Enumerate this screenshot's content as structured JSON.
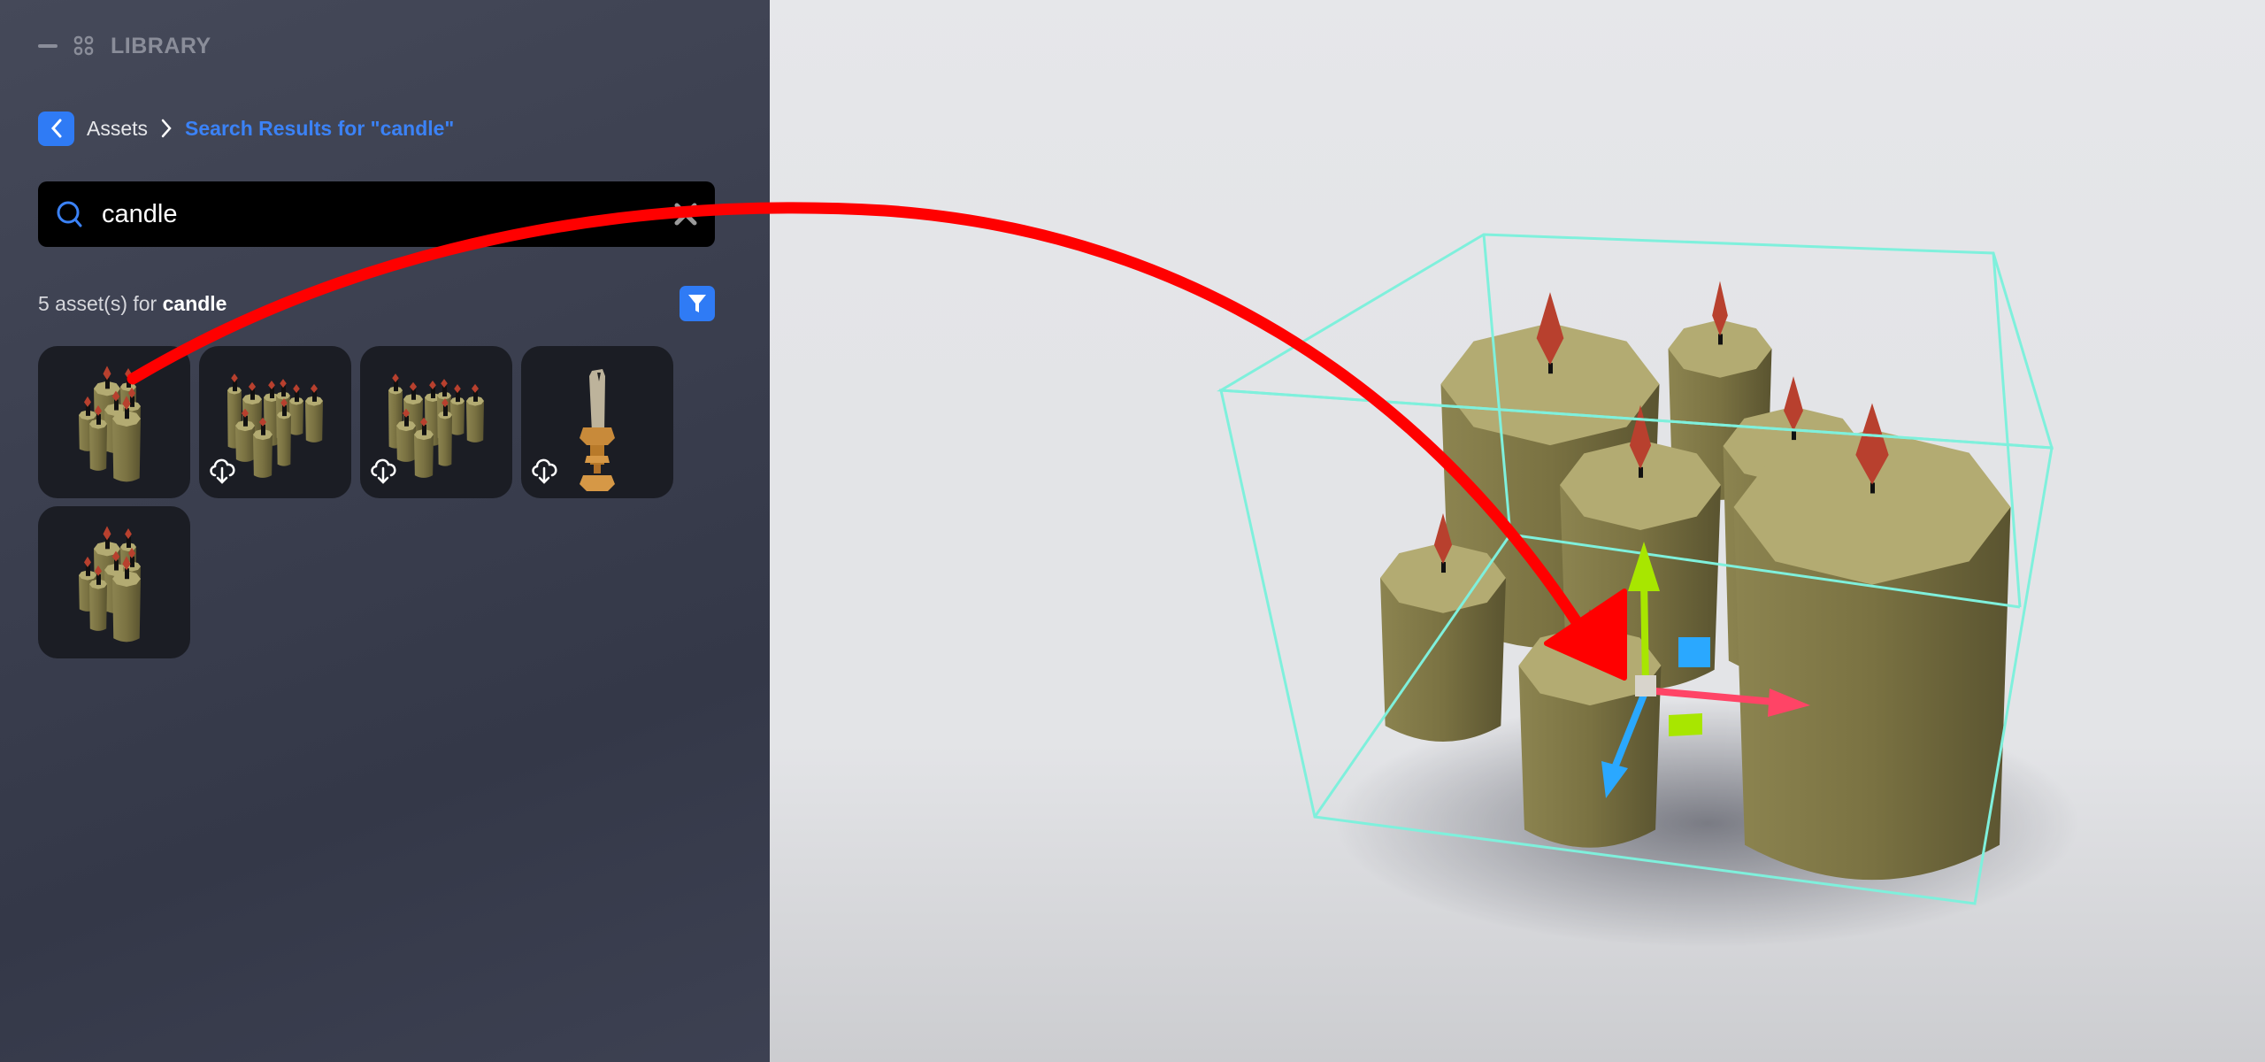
{
  "library": {
    "title": "LIBRARY",
    "collapse_icon": "minus-icon",
    "grid_icon": "grid-icon"
  },
  "breadcrumb": {
    "back_icon": "chevron-left-icon",
    "root": "Assets",
    "separator_icon": "chevron-right-icon",
    "current": "Search Results for \"candle\""
  },
  "search": {
    "value": "candle",
    "icon": "search-icon",
    "clear_icon": "close-icon"
  },
  "results": {
    "count_prefix": "5 asset(s) for",
    "query": "candle",
    "filter_icon": "filter-icon",
    "assets": [
      {
        "kind": "candle-cluster",
        "downloaded": true
      },
      {
        "kind": "candle-group",
        "downloaded": false
      },
      {
        "kind": "candle-group",
        "downloaded": false
      },
      {
        "kind": "candlestick",
        "downloaded": false
      },
      {
        "kind": "candle-cluster",
        "downloaded": true
      }
    ]
  },
  "colors": {
    "accent": "#2f7bf5",
    "annotation_arrow": "#ff0000",
    "selection_box": "#7ff0dc",
    "gizmo_x": "#ff4466",
    "gizmo_y": "#a8e600",
    "gizmo_z": "#2aa8ff",
    "candle_wax": "#8f8650",
    "flame": "#b8402e"
  }
}
